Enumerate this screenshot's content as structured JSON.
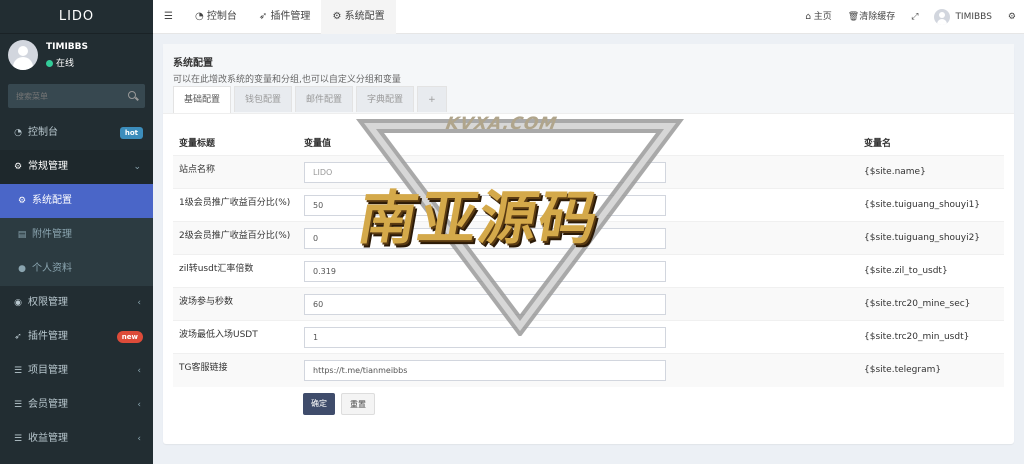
{
  "brand": "LIDO",
  "user": {
    "name": "TIMIBBS",
    "status": "在线"
  },
  "search": {
    "placeholder": "搜索菜单"
  },
  "menu": [
    {
      "label": "控制台",
      "icon": "dashboard-icon",
      "badge": "hot"
    },
    {
      "label": "常规管理",
      "icon": "cogs-icon"
    },
    {
      "label": "系统配置",
      "icon": "gear-icon"
    },
    {
      "label": "附件管理",
      "icon": "file-image-icon"
    },
    {
      "label": "个人资料",
      "icon": "user-icon"
    },
    {
      "label": "权限管理",
      "icon": "users-icon"
    },
    {
      "label": "插件管理",
      "icon": "rocket-icon",
      "badge": "new"
    },
    {
      "label": "项目管理",
      "icon": "list-icon"
    },
    {
      "label": "会员管理",
      "icon": "list-icon"
    },
    {
      "label": "收益管理",
      "icon": "list-icon"
    }
  ],
  "topnav": {
    "tabs": [
      "控制台",
      "插件管理",
      "系统配置"
    ],
    "home": "主页",
    "clear_cache": "清除缓存",
    "username": "TIMIBBS"
  },
  "page": {
    "title": "系统配置",
    "subtitle": "可以在此增改系统的变量和分组,也可以自定义分组和变量",
    "tabs": [
      "基础配置",
      "钱包配置",
      "邮件配置",
      "字典配置",
      "+"
    ]
  },
  "table": {
    "headers": [
      "变量标题",
      "变量值",
      "变量名"
    ],
    "rows": [
      {
        "title": "站点名称",
        "value": "LIDO",
        "name": "{$site.name}"
      },
      {
        "title": "1级会员推广收益百分比(%)",
        "value": "50",
        "name": "{$site.tuiguang_shouyi1}"
      },
      {
        "title": "2级会员推广收益百分比(%)",
        "value": "0",
        "name": "{$site.tuiguang_shouyi2}"
      },
      {
        "title": "zil转usdt汇率倍数",
        "value": "0.319",
        "name": "{$site.zil_to_usdt}"
      },
      {
        "title": "波场参与秒数",
        "value": "60",
        "name": "{$site.trc20_mine_sec}"
      },
      {
        "title": "波场最低入场USDT",
        "value": "1",
        "name": "{$site.trc20_min_usdt}"
      },
      {
        "title": "TG客服链接",
        "value": "https://t.me/tianmeibbs",
        "name": "{$site.telegram}"
      }
    ]
  },
  "buttons": {
    "submit": "确定",
    "reset": "重置"
  },
  "watermark": {
    "top": "KVXA.COM",
    "main": "南亚源码"
  },
  "colors": {
    "sidebar": "#222d32",
    "active": "#4a66c8",
    "primary": "#3f4c6b"
  }
}
